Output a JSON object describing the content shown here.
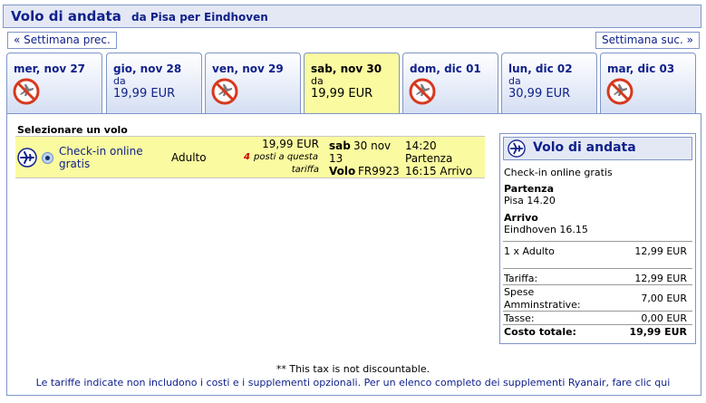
{
  "header": {
    "title": "Volo di andata",
    "subtitle": "da Pisa per Eindhoven"
  },
  "nav": {
    "prev_label": "« Settimana prec.",
    "next_label": "Settimana suc. »"
  },
  "days": [
    {
      "label": "mer, nov 27",
      "available": false,
      "selected": false
    },
    {
      "label": "gio, nov 28",
      "available": true,
      "selected": false,
      "da": "da",
      "price": "19,99 EUR"
    },
    {
      "label": "ven, nov 29",
      "available": false,
      "selected": false
    },
    {
      "label": "sab, nov 30",
      "available": true,
      "selected": true,
      "da": "da",
      "price": "19,99 EUR"
    },
    {
      "label": "dom, dic 01",
      "available": false,
      "selected": false
    },
    {
      "label": "lun, dic 02",
      "available": true,
      "selected": false,
      "da": "da",
      "price": "30,99 EUR"
    },
    {
      "label": "mar, dic 03",
      "available": false,
      "selected": false
    }
  ],
  "selection": {
    "title": "Selezionare un volo",
    "flight": {
      "fare_name_line1": "Check-in online",
      "fare_name_line2": "gratis",
      "passenger": "Adulto",
      "price": "19,99 EUR",
      "seats_count": "4",
      "seats_text_line1": "posti a questa",
      "seats_text_line2": "tariffa",
      "day": "sab",
      "date_line1": "30 nov",
      "date_line2": "13",
      "depart_time": "14:20",
      "depart_label": "Partenza",
      "flight_label": "Volo",
      "flight_number": "FR9923",
      "arrive": "16:15 Arrivo"
    }
  },
  "summary": {
    "title": "Volo di andata",
    "fare_type": "Check-in online gratis",
    "departure_label": "Partenza",
    "departure_value": "Pisa 14.20",
    "arrival_label": "Arrivo",
    "arrival_value": "Eindhoven 16.15",
    "pax_label": "1 x Adulto",
    "pax_value": "12,99 EUR",
    "tariffa_label": "Tariffa:",
    "tariffa_value": "12,99 EUR",
    "spese_label_line1": "Spese",
    "spese_label_line2": "Amminstrative:",
    "spese_value": "7,00 EUR",
    "tasse_label": "Tasse:",
    "tasse_value": "0,00 EUR",
    "totale_label": "Costo totale:",
    "totale_value": "19,99 EUR"
  },
  "footer": {
    "note": "** This tax is not discountable.",
    "link": "Le tariffe indicate non includono i costi e i supplementi opzionali. Per un elenco completo dei supplementi Ryanair, fare clic qui"
  },
  "colors": {
    "brand_blue": "#10218b",
    "highlight_yellow": "#fafaa0",
    "border_blue": "#7f95c8"
  }
}
